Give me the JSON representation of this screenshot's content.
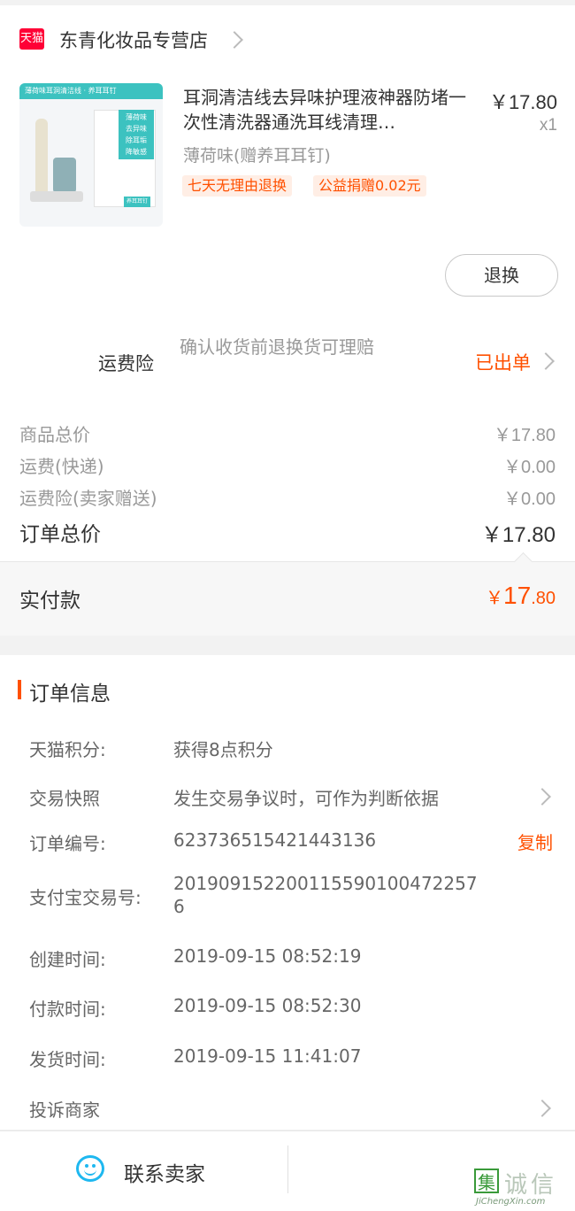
{
  "shop": {
    "badge": "天猫",
    "name": "东青化妆品专营店"
  },
  "product": {
    "image_header": "薄荷味耳洞清洁线 · 养耳耳钉",
    "image_tag_lines": [
      "薄荷味",
      "去异味",
      "除耳垢",
      "降敏感"
    ],
    "image_bottom": "养耳耳钉",
    "title": "耳洞清洁线去异味护理液神器防堵一次性清洗器通洗耳线清理…",
    "price": "￥17.80",
    "qty": "x1",
    "variant": "薄荷味(赠养耳耳钉)",
    "tags": [
      "七天无理由退换",
      "公益捐赠0.02元"
    ],
    "action_button": "退换"
  },
  "insurance": {
    "label": "运费险",
    "desc": "确认收货前退换货可理赔",
    "status": "已出单"
  },
  "summary": {
    "rows": [
      {
        "label": "商品总价",
        "value": "￥17.80"
      },
      {
        "label": "运费(快递)",
        "value": "￥0.00"
      },
      {
        "label": "运费险(卖家赠送)",
        "value": "￥0.00"
      }
    ],
    "total_label": "订单总价",
    "total_value": "￥17.80"
  },
  "paid": {
    "label": "实付款",
    "currency": "￥",
    "int_part": "17",
    "dec_part": ".80"
  },
  "order_info": {
    "title": "订单信息",
    "points_label": "天猫积分:",
    "points_value": "获得8点积分",
    "snapshot_label": "交易快照",
    "snapshot_value": "发生交易争议时，可作为判断依据",
    "order_no_label": "订单编号:",
    "order_no_value": "623736515421443136",
    "copy_label": "复制",
    "alipay_label": "支付宝交易号:",
    "alipay_line1": "20190915220011559010047225​7",
    "alipay_line2": "6",
    "created_label": "创建时间:",
    "created_value": "2019-09-15 08:52:19",
    "paid_label": "付款时间:",
    "paid_value": "2019-09-15 08:52:30",
    "shipped_label": "发货时间:",
    "shipped_value": "2019-09-15 11:41:07",
    "complain_label": "投诉商家"
  },
  "bottom_bar": {
    "contact_label": "联系卖家"
  },
  "watermark": {
    "mark": "集",
    "text": "诚信",
    "site": "JiChengXin.com"
  },
  "colors": {
    "accent": "#ff5000",
    "tmall_red": "#ff0036",
    "contact_blue": "#1eb8f0"
  }
}
